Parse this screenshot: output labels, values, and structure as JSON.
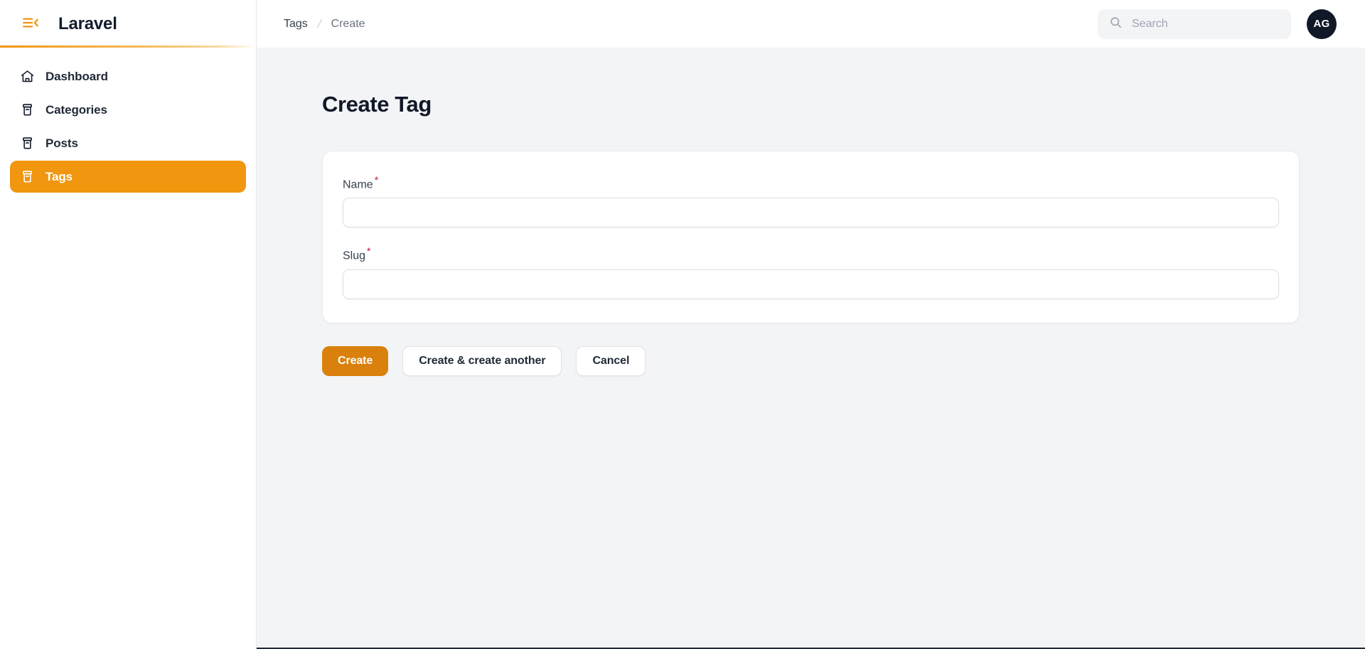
{
  "sidebar": {
    "collapse_icon": "bars-arrow-left-icon",
    "brand": "Laravel",
    "items": [
      {
        "label": "Dashboard",
        "icon": "home-icon",
        "active": false
      },
      {
        "label": "Categories",
        "icon": "archive-box-icon",
        "active": false
      },
      {
        "label": "Posts",
        "icon": "archive-box-icon",
        "active": false
      },
      {
        "label": "Tags",
        "icon": "archive-box-icon",
        "active": true
      }
    ]
  },
  "topbar": {
    "breadcrumb": {
      "parent": "Tags",
      "separator": "/",
      "current": "Create"
    },
    "search": {
      "placeholder": "Search",
      "value": "",
      "icon": "search-icon"
    },
    "avatar": {
      "initials": "AG"
    }
  },
  "main": {
    "page_title": "Create Tag",
    "form": {
      "fields": [
        {
          "label": "Name",
          "required": true,
          "required_mark": "*",
          "value": "",
          "placeholder": ""
        },
        {
          "label": "Slug",
          "required": true,
          "required_mark": "*",
          "value": "",
          "placeholder": ""
        }
      ]
    },
    "actions": {
      "create": "Create",
      "create_another": "Create & create another",
      "cancel": "Cancel"
    }
  },
  "colors": {
    "accent": "#f0960f",
    "primary_button": "#d9810c",
    "page_background": "#f3f4f6",
    "text_dark": "#111827",
    "required": "#be123c",
    "avatar_background": "#111827"
  }
}
